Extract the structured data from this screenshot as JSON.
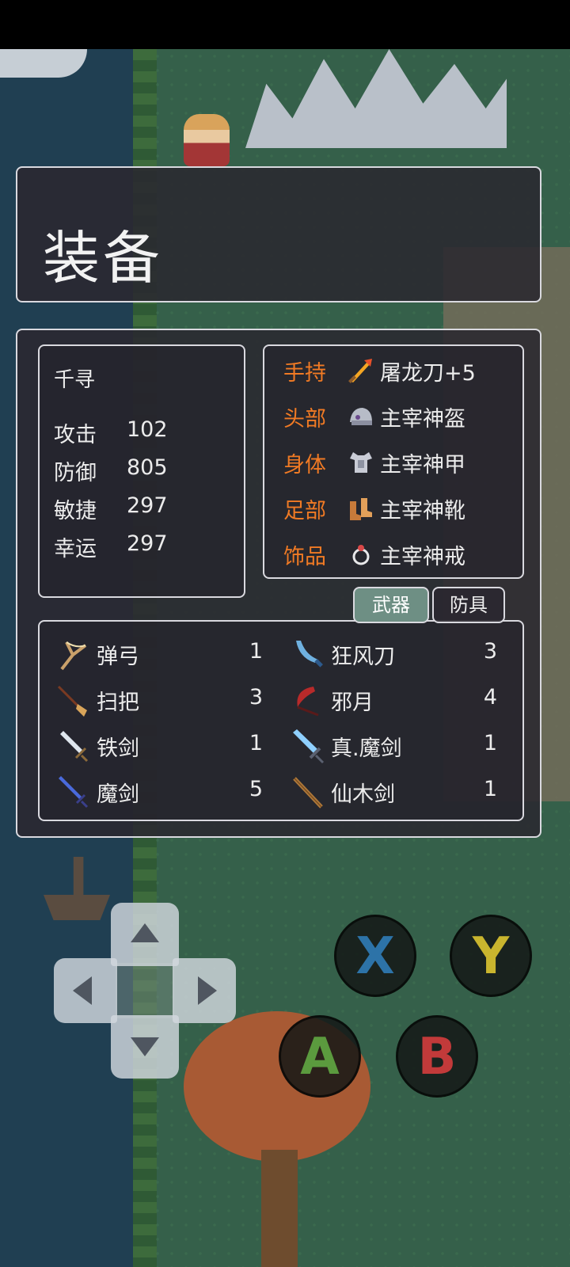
{
  "screen": {
    "title": "装备"
  },
  "character": {
    "name": "千寻",
    "stats": [
      {
        "label": "攻击",
        "value": "102"
      },
      {
        "label": "防御",
        "value": "805"
      },
      {
        "label": "敏捷",
        "value": "297"
      },
      {
        "label": "幸运",
        "value": "297"
      }
    ]
  },
  "equipment": [
    {
      "slot": "手持",
      "item": "屠龙刀+5",
      "icon": "fire-sword-icon"
    },
    {
      "slot": "头部",
      "item": "主宰神盔",
      "icon": "helmet-icon"
    },
    {
      "slot": "身体",
      "item": "主宰神甲",
      "icon": "armor-icon"
    },
    {
      "slot": "足部",
      "item": "主宰神靴",
      "icon": "boots-icon"
    },
    {
      "slot": "饰品",
      "item": "主宰神戒",
      "icon": "ring-icon"
    }
  ],
  "tabs": {
    "weapons": "武器",
    "armor": "防具",
    "selected": "weapons"
  },
  "inventory": [
    {
      "name": "弹弓",
      "count": "1",
      "icon": "slingshot-icon"
    },
    {
      "name": "狂风刀",
      "count": "3",
      "icon": "curved-blade-icon"
    },
    {
      "name": "扫把",
      "count": "3",
      "icon": "broom-icon"
    },
    {
      "name": "邪月",
      "count": "4",
      "icon": "sickle-icon"
    },
    {
      "name": "铁剑",
      "count": "1",
      "icon": "iron-sword-icon"
    },
    {
      "name": "真.魔剑",
      "count": "1",
      "icon": "magic-sword-icon"
    },
    {
      "name": "魔剑",
      "count": "5",
      "icon": "demon-sword-icon"
    },
    {
      "name": "仙木剑",
      "count": "1",
      "icon": "wood-sword-icon"
    }
  ],
  "controls": {
    "x": "X",
    "y": "Y",
    "a": "A",
    "b": "B"
  },
  "colors": {
    "slot_label": "#f07a24",
    "panel_border": "#d9d9df",
    "selected_tab": "#6e8f84",
    "btn_x": "#2d73a8",
    "btn_y": "#c9b52e",
    "btn_a": "#5b9a3e",
    "btn_b": "#c23a3a"
  }
}
